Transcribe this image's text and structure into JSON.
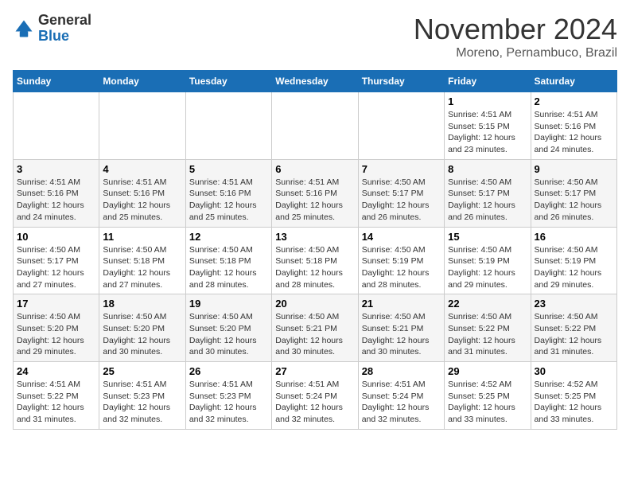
{
  "header": {
    "logo_line1": "General",
    "logo_line2": "Blue",
    "month": "November 2024",
    "location": "Moreno, Pernambuco, Brazil"
  },
  "weekdays": [
    "Sunday",
    "Monday",
    "Tuesday",
    "Wednesday",
    "Thursday",
    "Friday",
    "Saturday"
  ],
  "weeks": [
    [
      {
        "day": "",
        "info": ""
      },
      {
        "day": "",
        "info": ""
      },
      {
        "day": "",
        "info": ""
      },
      {
        "day": "",
        "info": ""
      },
      {
        "day": "",
        "info": ""
      },
      {
        "day": "1",
        "info": "Sunrise: 4:51 AM\nSunset: 5:15 PM\nDaylight: 12 hours and 23 minutes."
      },
      {
        "day": "2",
        "info": "Sunrise: 4:51 AM\nSunset: 5:16 PM\nDaylight: 12 hours and 24 minutes."
      }
    ],
    [
      {
        "day": "3",
        "info": "Sunrise: 4:51 AM\nSunset: 5:16 PM\nDaylight: 12 hours and 24 minutes."
      },
      {
        "day": "4",
        "info": "Sunrise: 4:51 AM\nSunset: 5:16 PM\nDaylight: 12 hours and 25 minutes."
      },
      {
        "day": "5",
        "info": "Sunrise: 4:51 AM\nSunset: 5:16 PM\nDaylight: 12 hours and 25 minutes."
      },
      {
        "day": "6",
        "info": "Sunrise: 4:51 AM\nSunset: 5:16 PM\nDaylight: 12 hours and 25 minutes."
      },
      {
        "day": "7",
        "info": "Sunrise: 4:50 AM\nSunset: 5:17 PM\nDaylight: 12 hours and 26 minutes."
      },
      {
        "day": "8",
        "info": "Sunrise: 4:50 AM\nSunset: 5:17 PM\nDaylight: 12 hours and 26 minutes."
      },
      {
        "day": "9",
        "info": "Sunrise: 4:50 AM\nSunset: 5:17 PM\nDaylight: 12 hours and 26 minutes."
      }
    ],
    [
      {
        "day": "10",
        "info": "Sunrise: 4:50 AM\nSunset: 5:17 PM\nDaylight: 12 hours and 27 minutes."
      },
      {
        "day": "11",
        "info": "Sunrise: 4:50 AM\nSunset: 5:18 PM\nDaylight: 12 hours and 27 minutes."
      },
      {
        "day": "12",
        "info": "Sunrise: 4:50 AM\nSunset: 5:18 PM\nDaylight: 12 hours and 28 minutes."
      },
      {
        "day": "13",
        "info": "Sunrise: 4:50 AM\nSunset: 5:18 PM\nDaylight: 12 hours and 28 minutes."
      },
      {
        "day": "14",
        "info": "Sunrise: 4:50 AM\nSunset: 5:19 PM\nDaylight: 12 hours and 28 minutes."
      },
      {
        "day": "15",
        "info": "Sunrise: 4:50 AM\nSunset: 5:19 PM\nDaylight: 12 hours and 29 minutes."
      },
      {
        "day": "16",
        "info": "Sunrise: 4:50 AM\nSunset: 5:19 PM\nDaylight: 12 hours and 29 minutes."
      }
    ],
    [
      {
        "day": "17",
        "info": "Sunrise: 4:50 AM\nSunset: 5:20 PM\nDaylight: 12 hours and 29 minutes."
      },
      {
        "day": "18",
        "info": "Sunrise: 4:50 AM\nSunset: 5:20 PM\nDaylight: 12 hours and 30 minutes."
      },
      {
        "day": "19",
        "info": "Sunrise: 4:50 AM\nSunset: 5:20 PM\nDaylight: 12 hours and 30 minutes."
      },
      {
        "day": "20",
        "info": "Sunrise: 4:50 AM\nSunset: 5:21 PM\nDaylight: 12 hours and 30 minutes."
      },
      {
        "day": "21",
        "info": "Sunrise: 4:50 AM\nSunset: 5:21 PM\nDaylight: 12 hours and 30 minutes."
      },
      {
        "day": "22",
        "info": "Sunrise: 4:50 AM\nSunset: 5:22 PM\nDaylight: 12 hours and 31 minutes."
      },
      {
        "day": "23",
        "info": "Sunrise: 4:50 AM\nSunset: 5:22 PM\nDaylight: 12 hours and 31 minutes."
      }
    ],
    [
      {
        "day": "24",
        "info": "Sunrise: 4:51 AM\nSunset: 5:22 PM\nDaylight: 12 hours and 31 minutes."
      },
      {
        "day": "25",
        "info": "Sunrise: 4:51 AM\nSunset: 5:23 PM\nDaylight: 12 hours and 32 minutes."
      },
      {
        "day": "26",
        "info": "Sunrise: 4:51 AM\nSunset: 5:23 PM\nDaylight: 12 hours and 32 minutes."
      },
      {
        "day": "27",
        "info": "Sunrise: 4:51 AM\nSunset: 5:24 PM\nDaylight: 12 hours and 32 minutes."
      },
      {
        "day": "28",
        "info": "Sunrise: 4:51 AM\nSunset: 5:24 PM\nDaylight: 12 hours and 32 minutes."
      },
      {
        "day": "29",
        "info": "Sunrise: 4:52 AM\nSunset: 5:25 PM\nDaylight: 12 hours and 33 minutes."
      },
      {
        "day": "30",
        "info": "Sunrise: 4:52 AM\nSunset: 5:25 PM\nDaylight: 12 hours and 33 minutes."
      }
    ]
  ]
}
